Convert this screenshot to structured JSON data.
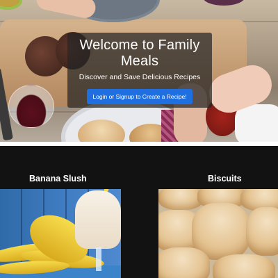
{
  "hero": {
    "title": "Welcome to Family Meals",
    "subtitle": "Discover and Save Delicious Recipes",
    "cta_label": "Login or Signup to Create a Recipe!"
  },
  "recipes": [
    {
      "title": "Banana Slush"
    },
    {
      "title": "Biscuits"
    }
  ],
  "colors": {
    "accent": "#1f6fe0",
    "background": "#121212",
    "overlay": "#262626"
  }
}
